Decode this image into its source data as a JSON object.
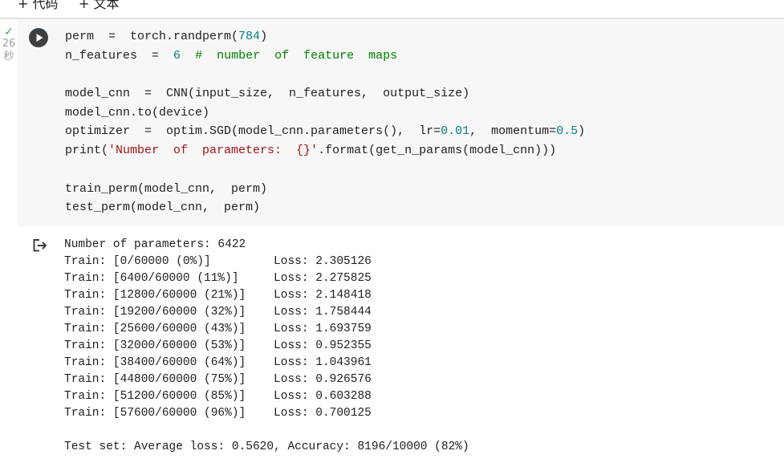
{
  "toolbar": {
    "code_label": "+ 代码",
    "text_label": "+ 文本"
  },
  "cell": {
    "status_check": "✓",
    "exec_time_value": "26",
    "exec_time_unit": "秒",
    "code_lines": [
      "perm  =  torch.randperm(784)",
      "n_features  =  6  #  number  of  feature  maps",
      "",
      "model_cnn  =  CNN(input_size,  n_features,  output_size)",
      "model_cnn.to(device)",
      "optimizer  =  optim.SGD(model_cnn.parameters(),  lr=0.01,  momentum=0.5)",
      "print('Number  of  parameters:  {}'.format(get_n_params(model_cnn)))",
      "",
      "train_perm(model_cnn,  perm)",
      "test_perm(model_cnn,  perm)"
    ]
  },
  "output": {
    "lines": [
      "Number of parameters: 6422",
      "Train: [0/60000 (0%)]\tLoss: 2.305126",
      "Train: [6400/60000 (11%)]\tLoss: 2.275825",
      "Train: [12800/60000 (21%)]\tLoss: 2.148418",
      "Train: [19200/60000 (32%)]\tLoss: 1.758444",
      "Train: [25600/60000 (43%)]\tLoss: 1.693759",
      "Train: [32000/60000 (53%)]\tLoss: 0.952355",
      "Train: [38400/60000 (64%)]\tLoss: 1.043961",
      "Train: [44800/60000 (75%)]\tLoss: 0.926576",
      "Train: [51200/60000 (85%)]\tLoss: 0.603288",
      "Train: [57600/60000 (96%)]\tLoss: 0.700125",
      "",
      "Test set: Average loss: 0.5620, Accuracy: 8196/10000 (82%)"
    ]
  },
  "icons": {
    "run": "play-circle-icon",
    "output": "output-arrow-icon",
    "status": "check-icon"
  },
  "colors": {
    "cell_bg": "#f7f7f7",
    "number": "#008080",
    "comment": "#008000",
    "string": "#a31515",
    "check": "#34a853"
  }
}
